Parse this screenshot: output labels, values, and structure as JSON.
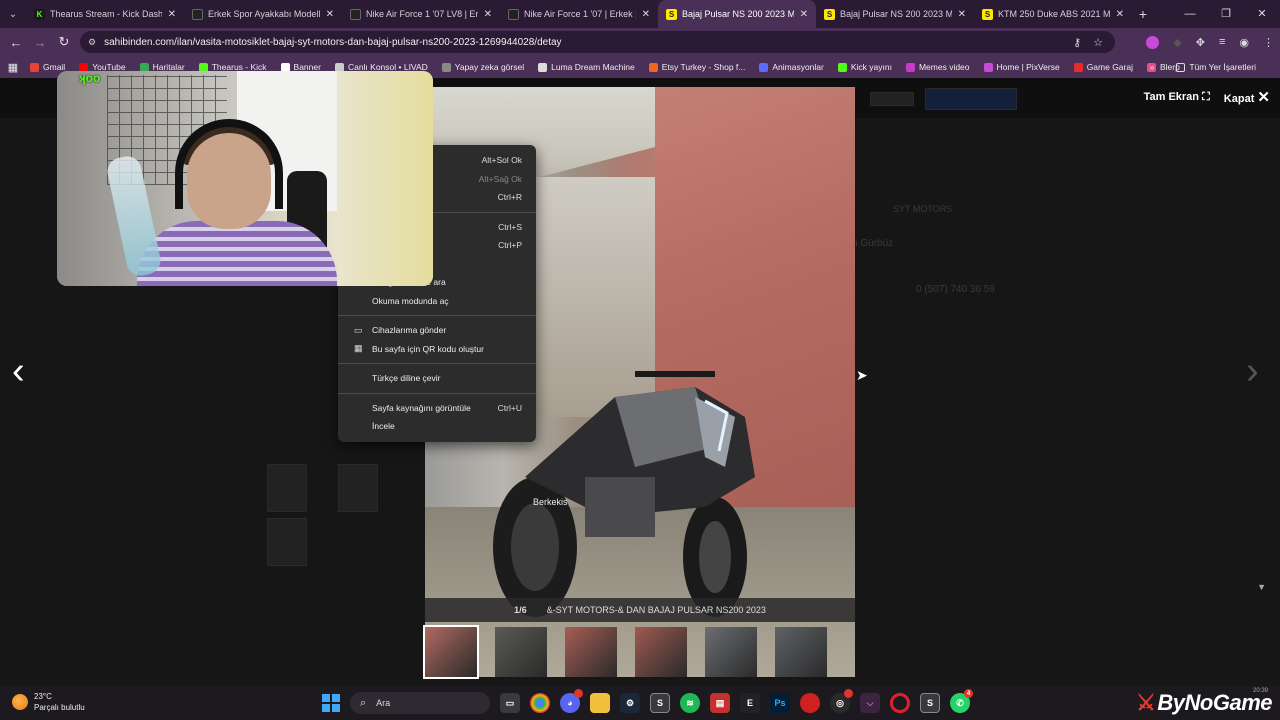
{
  "tabs": [
    {
      "title": "Thearus Stream - Kick Dashboard",
      "favicon": "K",
      "kind": "kick",
      "active": false
    },
    {
      "title": "Erkek Spor Ayakkabı Modelleri",
      "favicon": "",
      "kind": "nike",
      "active": false
    },
    {
      "title": "Nike Air Force 1 '07 LV8 | Erkek",
      "favicon": "",
      "kind": "nike",
      "active": false
    },
    {
      "title": "Nike Air Force 1 '07 | Erkek | CT",
      "favicon": "",
      "kind": "nike",
      "active": false
    },
    {
      "title": "Bajaj Pulsar NS 200 2023 Model",
      "favicon": "S",
      "kind": "sahi",
      "active": true
    },
    {
      "title": "Bajaj Pulsar NS 200 2023 Model",
      "favicon": "S",
      "kind": "sahi",
      "active": false
    },
    {
      "title": "KTM 250 Duke ABS 2021 Model",
      "favicon": "S",
      "kind": "sahi",
      "active": false
    }
  ],
  "toolbar": {
    "url": "sahibinden.com/ilan/vasita-motosiklet-bajaj-syt-motors-dan-bajaj-pulsar-ns200-2023-1269944028/detay"
  },
  "bookmarks": [
    {
      "label": "Gmail",
      "color": "#ea4335"
    },
    {
      "label": "YouTube",
      "color": "#ff0000"
    },
    {
      "label": "Haritalar",
      "color": "#34a853"
    },
    {
      "label": "Thearus - Kick",
      "color": "#53fc18"
    },
    {
      "label": "Banner",
      "color": "#ffffff"
    },
    {
      "label": "Canlı Konsol • LIVAD",
      "color": "#cccccc"
    },
    {
      "label": "Yapay zeka görsel",
      "color": "#888888"
    },
    {
      "label": "Luma Dream Machine",
      "color": "#dddddd"
    },
    {
      "label": "Etsy Turkey - Shop f...",
      "color": "#f16521"
    },
    {
      "label": "Animasyonlar",
      "color": "#5b6bff"
    },
    {
      "label": "Kick yayını",
      "color": "#53fc18"
    },
    {
      "label": "Memes video",
      "color": "#c33cc3"
    },
    {
      "label": "Home | PixVerse",
      "color": "#c84ad8"
    },
    {
      "label": "Game Garaj",
      "color": "#e82c2c"
    },
    {
      "label": "Blerp",
      "color": "#e84a8a"
    }
  ],
  "bookmarks_more": "»",
  "bookmarks_all": "Tüm Yer İşaretleri",
  "viewer": {
    "fullscreen_label": "Tam Ekran",
    "close_label": "Kapat",
    "counter": "1/6",
    "caption": "&-SYT MOTORS-& DAN BAJAJ PULSAR NS200 2023",
    "watermark": "sahibinden.com",
    "thumb_count": 6,
    "moto_plate": "Berkekis"
  },
  "context_menu": {
    "items": [
      {
        "label": "",
        "shortcut": "Alt+Sol Ok",
        "disabled": false,
        "icon": ""
      },
      {
        "label": "",
        "shortcut": "Alt+Sağ Ok",
        "disabled": true,
        "icon": ""
      },
      {
        "label": "",
        "shortcut": "Ctrl+R",
        "disabled": false,
        "icon": ""
      },
      {
        "sep": true
      },
      {
        "label": "",
        "shortcut": "Ctrl+S",
        "disabled": false,
        "icon": ""
      },
      {
        "label": "",
        "shortcut": "Ctrl+P",
        "disabled": false,
        "icon": ""
      },
      {
        "label": "",
        "shortcut": "",
        "disabled": false,
        "icon": ""
      },
      {
        "label": "Google Lens ile ara",
        "shortcut": "",
        "disabled": false,
        "icon": "lens-icon"
      },
      {
        "label": "Okuma modunda aç",
        "shortcut": "",
        "disabled": false,
        "icon": ""
      },
      {
        "sep": true
      },
      {
        "label": "Cihazlarıma gönder",
        "shortcut": "",
        "disabled": false,
        "icon": "send-device-icon"
      },
      {
        "label": "Bu sayfa için QR kodu oluştur",
        "shortcut": "",
        "disabled": false,
        "icon": "qr-icon"
      },
      {
        "sep": true
      },
      {
        "label": "Türkçe diline çevir",
        "shortcut": "",
        "disabled": false,
        "icon": ""
      },
      {
        "sep": true
      },
      {
        "label": "Sayfa kaynağını görüntüle",
        "shortcut": "Ctrl+U",
        "disabled": false,
        "icon": ""
      },
      {
        "label": "İncele",
        "shortcut": "",
        "disabled": false,
        "icon": ""
      }
    ]
  },
  "background_page": {
    "phone": "0 (507) 740 36 59",
    "seller_fragment": "n Gürbüz",
    "store_label": "SYT MOTORS"
  },
  "taskbar": {
    "temperature": "23°C",
    "weather": "Parçalı bulutlu",
    "search_placeholder": "Ara",
    "brand": "ByNoGame",
    "time": "20:39"
  },
  "colors": {
    "accent_kick": "#53fc18",
    "sahibinden_yellow": "#ffe800",
    "chrome_frame": "#4a2f57",
    "menu_bg": "#2c2c2c"
  }
}
